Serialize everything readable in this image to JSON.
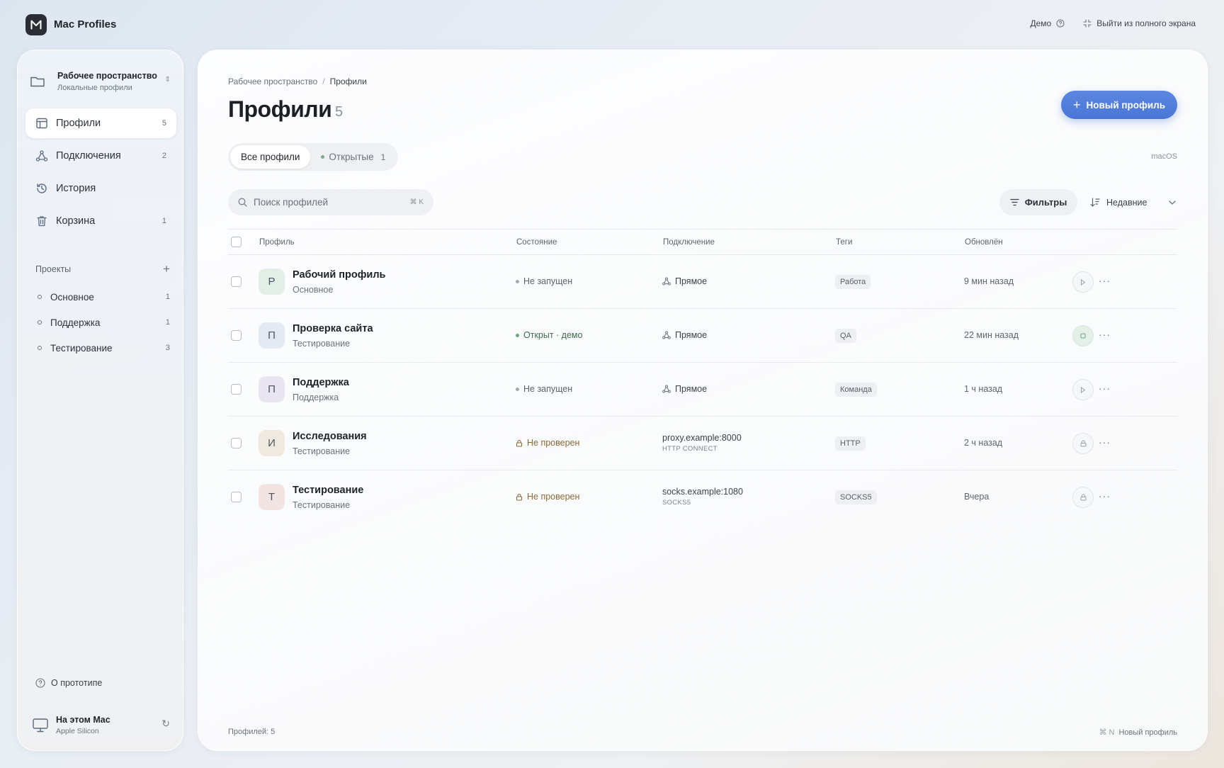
{
  "app": {
    "title": "Mac Profiles",
    "logo_letter": "M"
  },
  "topbar": {
    "demo_label": "Демо",
    "exit_fullscreen_label": "Выйти из полного экрана"
  },
  "workspace": {
    "title": "Рабочее пространство",
    "subtitle": "Локальные профили"
  },
  "nav": [
    {
      "label": "Профили",
      "count": "5",
      "icon": "profiles-icon",
      "active": true
    },
    {
      "label": "Подключения",
      "count": "2",
      "icon": "connections-icon",
      "active": false
    },
    {
      "label": "История",
      "count": "",
      "icon": "history-icon",
      "active": false
    },
    {
      "label": "Корзина",
      "count": "1",
      "icon": "trash-icon",
      "active": false
    }
  ],
  "projects": {
    "heading": "Проекты",
    "items": [
      {
        "label": "Основное",
        "count": "1"
      },
      {
        "label": "Поддержка",
        "count": "1"
      },
      {
        "label": "Тестирование",
        "count": "3"
      }
    ]
  },
  "about_label": "О прототипе",
  "device": {
    "title": "На этом Mac",
    "subtitle": "Apple Silicon"
  },
  "main": {
    "breadcrumb": {
      "root": "Рабочее пространство",
      "separator": "/",
      "current": "Профили"
    },
    "title": "Профили",
    "title_count": "5",
    "new_profile_label": "Новый профиль",
    "tabs": [
      {
        "label": "Все профили",
        "count": "",
        "active": true
      },
      {
        "label": "Открытые",
        "count": "1",
        "active": false
      }
    ],
    "os_label": "macOS",
    "search": {
      "placeholder": "Поиск профилей",
      "shortcut": "⌘ K"
    },
    "filters_label": "Фильтры",
    "sort_label": "Недавние",
    "columns": [
      "Профиль",
      "Состояние",
      "Подключение",
      "Теги",
      "Обновлён"
    ],
    "rows": [
      {
        "initial": "Р",
        "name": "Рабочий профиль",
        "project": "Основное",
        "state": "Не запущен",
        "state_kind": "idle",
        "connection": "Прямое",
        "connection_sub": "",
        "tag": "Работа",
        "updated": "9 мин назад",
        "avatar_color": "#e3efe6",
        "action": "play"
      },
      {
        "initial": "П",
        "name": "Проверка сайта",
        "project": "Тестирование",
        "state": "Открыт · демо",
        "state_kind": "open",
        "connection": "Прямое",
        "connection_sub": "",
        "tag": "QA",
        "updated": "22 мин назад",
        "avatar_color": "#e3eaf3",
        "action": "stop"
      },
      {
        "initial": "П",
        "name": "Поддержка",
        "project": "Поддержка",
        "state": "Не запущен",
        "state_kind": "idle",
        "connection": "Прямое",
        "connection_sub": "",
        "tag": "Команда",
        "updated": "1 ч назад",
        "avatar_color": "#e9e6f2",
        "action": "play"
      },
      {
        "initial": "И",
        "name": "Исследования",
        "project": "Тестирование",
        "state": "Не проверен",
        "state_kind": "warn",
        "connection": "proxy.example:8000",
        "connection_sub": "HTTP CONNECT",
        "tag": "HTTP",
        "updated": "2 ч назад",
        "avatar_color": "#efe9df",
        "action": "lock"
      },
      {
        "initial": "Т",
        "name": "Тестирование",
        "project": "Тестирование",
        "state": "Не проверен",
        "state_kind": "warn",
        "connection": "socks.example:1080",
        "connection_sub": "SOCKS5",
        "tag": "SOCKS5",
        "updated": "Вчера",
        "avatar_color": "#f2e4e2",
        "action": "lock"
      }
    ],
    "footer_count": "Профилей: 5",
    "footer_shortcut_key": "⌘ N",
    "footer_shortcut_label": "Новый профиль"
  },
  "colors": {
    "accent": "#4a76d6",
    "open_status": "#6fa582",
    "warn_status": "#8a6a35"
  }
}
